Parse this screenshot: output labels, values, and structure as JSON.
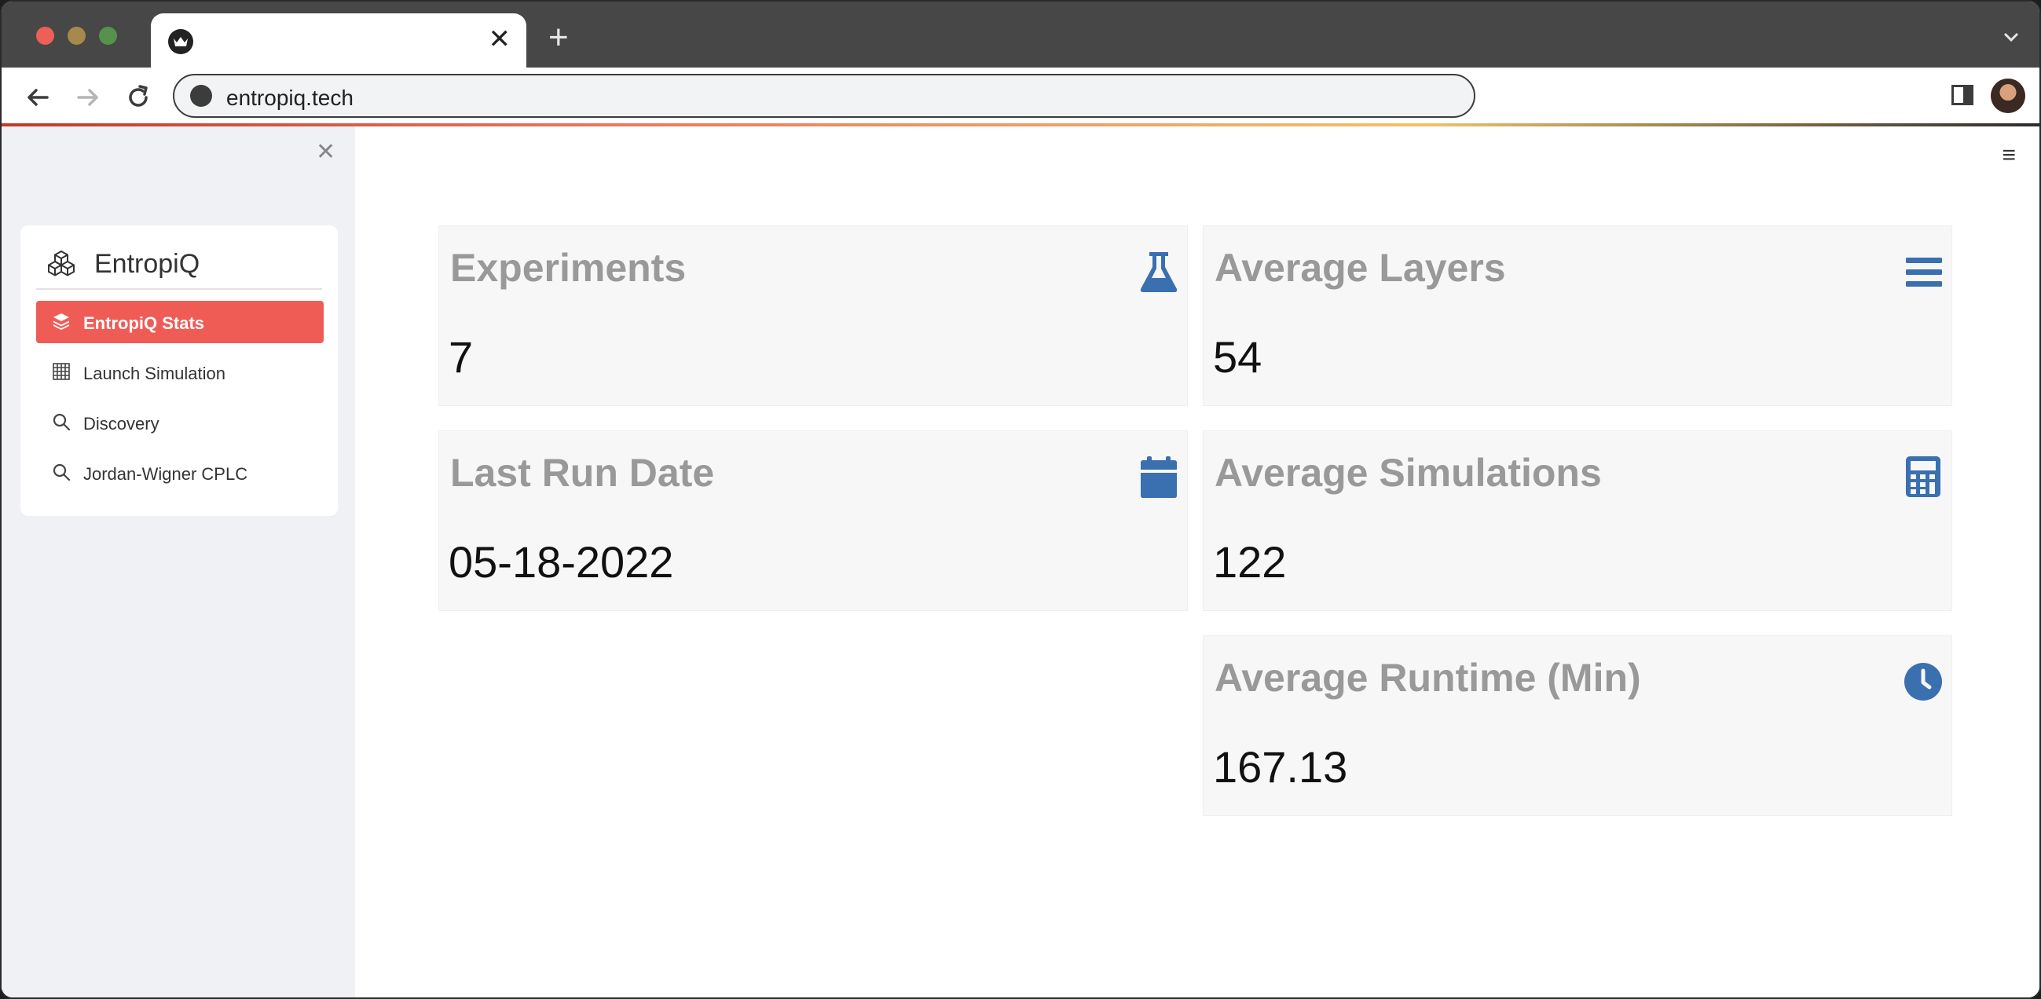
{
  "browser": {
    "url": "entropiq.tech",
    "new_tab_label": "+",
    "tab_close_label": "✕"
  },
  "sidebar": {
    "close_label": "✕",
    "brand": "EntropiQ",
    "items": [
      {
        "label": "EntropiQ Stats",
        "icon": "layers-icon",
        "active": true
      },
      {
        "label": "Launch Simulation",
        "icon": "grid-icon",
        "active": false
      },
      {
        "label": "Discovery",
        "icon": "search-icon",
        "active": false
      },
      {
        "label": "Jordan-Wigner CPLC",
        "icon": "search-icon",
        "active": false
      }
    ]
  },
  "header": {
    "menu_label": "≡"
  },
  "stats": {
    "experiments": {
      "title": "Experiments",
      "value": "7",
      "icon": "flask-icon"
    },
    "average_layers": {
      "title": "Average Layers",
      "value": "54",
      "icon": "bars-icon"
    },
    "last_run_date": {
      "title": "Last Run Date",
      "value": "05-18-2022",
      "icon": "calendar-icon"
    },
    "average_simulations": {
      "title": "Average Simulations",
      "value": "122",
      "icon": "calculator-icon"
    },
    "average_runtime": {
      "title": "Average Runtime (Min)",
      "value": "167.13",
      "icon": "clock-icon"
    }
  },
  "colors": {
    "accent": "#ef5c56",
    "icon_blue": "#3a6fb0",
    "title_gray": "#999999"
  }
}
